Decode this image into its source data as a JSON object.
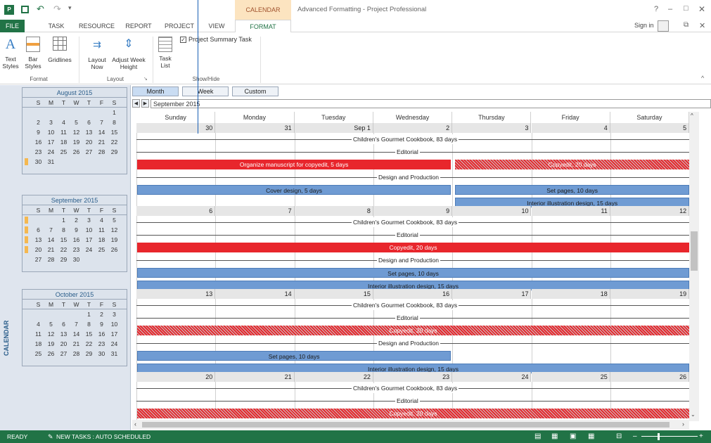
{
  "titlebar": {
    "context_tab": "CALENDAR TOOLS",
    "title": "Advanced Formatting - Project Professional",
    "help": "?",
    "signin": "Sign in"
  },
  "tabs": [
    "FILE",
    "TASK",
    "RESOURCE",
    "REPORT",
    "PROJECT",
    "VIEW",
    "FORMAT"
  ],
  "ribbon": {
    "text_styles": "Text Styles",
    "bar_styles": "Bar Styles",
    "gridlines": "Gridlines",
    "layout_now": "Layout Now",
    "adjust_week_height": "Adjust Week Height",
    "task_list": "Task List",
    "project_summary_task": "Project Summary Task",
    "groups": {
      "format": "Format",
      "layout": "Layout",
      "show_hide": "Show/Hide"
    }
  },
  "left_pane_label": "CALENDAR",
  "mini_months": [
    {
      "title": "August 2015",
      "days": [
        "S",
        "M",
        "T",
        "W",
        "T",
        "F",
        "S"
      ],
      "weeks": [
        [
          "",
          "",
          "",
          "",
          "",
          "",
          "1"
        ],
        [
          "2",
          "3",
          "4",
          "5",
          "6",
          "7",
          "8"
        ],
        [
          "9",
          "10",
          "11",
          "12",
          "13",
          "14",
          "15"
        ],
        [
          "16",
          "17",
          "18",
          "19",
          "20",
          "21",
          "22"
        ],
        [
          "23",
          "24",
          "25",
          "26",
          "27",
          "28",
          "29"
        ],
        [
          "30",
          "31",
          "",
          "",
          "",
          "",
          ""
        ]
      ],
      "marked_weeks": [
        5
      ]
    },
    {
      "title": "September 2015",
      "days": [
        "S",
        "M",
        "T",
        "W",
        "T",
        "F",
        "S"
      ],
      "weeks": [
        [
          "",
          "",
          "1",
          "2",
          "3",
          "4",
          "5"
        ],
        [
          "6",
          "7",
          "8",
          "9",
          "10",
          "11",
          "12"
        ],
        [
          "13",
          "14",
          "15",
          "16",
          "17",
          "18",
          "19"
        ],
        [
          "20",
          "21",
          "22",
          "23",
          "24",
          "25",
          "26"
        ],
        [
          "27",
          "28",
          "29",
          "30",
          "",
          "",
          ""
        ]
      ],
      "marked_weeks": [
        0,
        1,
        2,
        3
      ]
    },
    {
      "title": "October 2015",
      "days": [
        "S",
        "M",
        "T",
        "W",
        "T",
        "F",
        "S"
      ],
      "weeks": [
        [
          "",
          "",
          "",
          "",
          "",
          "1",
          "2",
          "3"
        ],
        [
          "4",
          "5",
          "6",
          "7",
          "8",
          "9",
          "10"
        ],
        [
          "11",
          "12",
          "13",
          "14",
          "15",
          "16",
          "17"
        ],
        [
          "18",
          "19",
          "20",
          "21",
          "22",
          "23",
          "24"
        ],
        [
          "25",
          "26",
          "27",
          "28",
          "29",
          "30",
          "31"
        ]
      ],
      "marked_weeks": []
    }
  ],
  "view_buttons": {
    "month": "Month",
    "week": "Week",
    "custom": "Custom"
  },
  "nav": {
    "current": "September 2015"
  },
  "weekdays": [
    "Sunday",
    "Monday",
    "Tuesday",
    "Wednesday",
    "Thursday",
    "Friday",
    "Saturday"
  ],
  "weeks": [
    {
      "dates": [
        "30",
        "31",
        "Sep 1",
        "2",
        "3",
        "4",
        "5"
      ]
    },
    {
      "dates": [
        "6",
        "7",
        "8",
        "9",
        "10",
        "11",
        "12"
      ]
    },
    {
      "dates": [
        "13",
        "14",
        "15",
        "16",
        "17",
        "18",
        "19"
      ]
    },
    {
      "dates": [
        "20",
        "21",
        "22",
        "23",
        "24",
        "25",
        "26"
      ]
    }
  ],
  "tasks": {
    "cookbook": "Children's Gourmet Cookbook, 83 days",
    "editorial": "Editorial",
    "organize": "Organize manuscript for copyedit, 5 days",
    "copyedit": "Copyedit, 20 days",
    "design_production": "Design and Production",
    "cover_design": "Cover design, 5 days",
    "set_pages": "Set pages, 10 days",
    "interior": "Interior illustration design, 15 days"
  },
  "statusbar": {
    "ready": "READY",
    "new_tasks": "NEW TASKS : AUTO SCHEDULED"
  }
}
